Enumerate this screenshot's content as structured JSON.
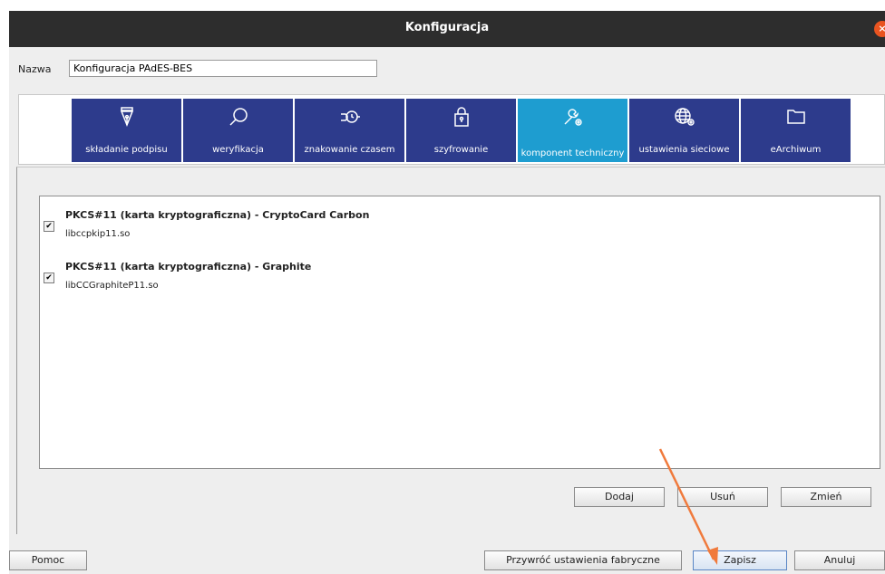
{
  "window": {
    "title": "Konfiguracja",
    "close_glyph": "×"
  },
  "name_field": {
    "label": "Nazwa",
    "value": "Konfiguracja PAdES-BES"
  },
  "tabs": [
    {
      "label": "składanie podpisu",
      "icon": "pen-nib-icon"
    },
    {
      "label": "weryfikacja",
      "icon": "magnifier-icon"
    },
    {
      "label": "znakowanie czasem",
      "icon": "hand-clock-icon"
    },
    {
      "label": "szyfrowanie",
      "icon": "padlock-icon"
    },
    {
      "label": "komponent techniczny",
      "icon": "wrench-gear-icon",
      "active": true
    },
    {
      "label": "ustawienia sieciowe",
      "icon": "globe-gear-icon"
    },
    {
      "label": "eArchiwum",
      "icon": "folder-icon"
    }
  ],
  "components": [
    {
      "title": "PKCS#11 (karta kryptograficzna)  -  CryptoCard Carbon",
      "library": "libccpkip11.so",
      "checked": true,
      "check_glyph": "✔"
    },
    {
      "title": "PKCS#11 (karta kryptograficzna)  -  Graphite",
      "library": "libCCGraphiteP11.so",
      "checked": true,
      "check_glyph": "✔"
    }
  ],
  "list_buttons": {
    "add": "Dodaj",
    "remove": "Usuń",
    "edit": "Zmień"
  },
  "footer": {
    "help": "Pomoc",
    "restore": "Przywróć ustawienia fabryczne",
    "save": "Zapisz",
    "cancel": "Anuluj"
  },
  "colors": {
    "tab": "#2d3b8c",
    "tab_active": "#1e9dd0",
    "titlebar": "#2d2d2d",
    "close": "#e95420",
    "annotation_arrow": "#f07a3c"
  }
}
